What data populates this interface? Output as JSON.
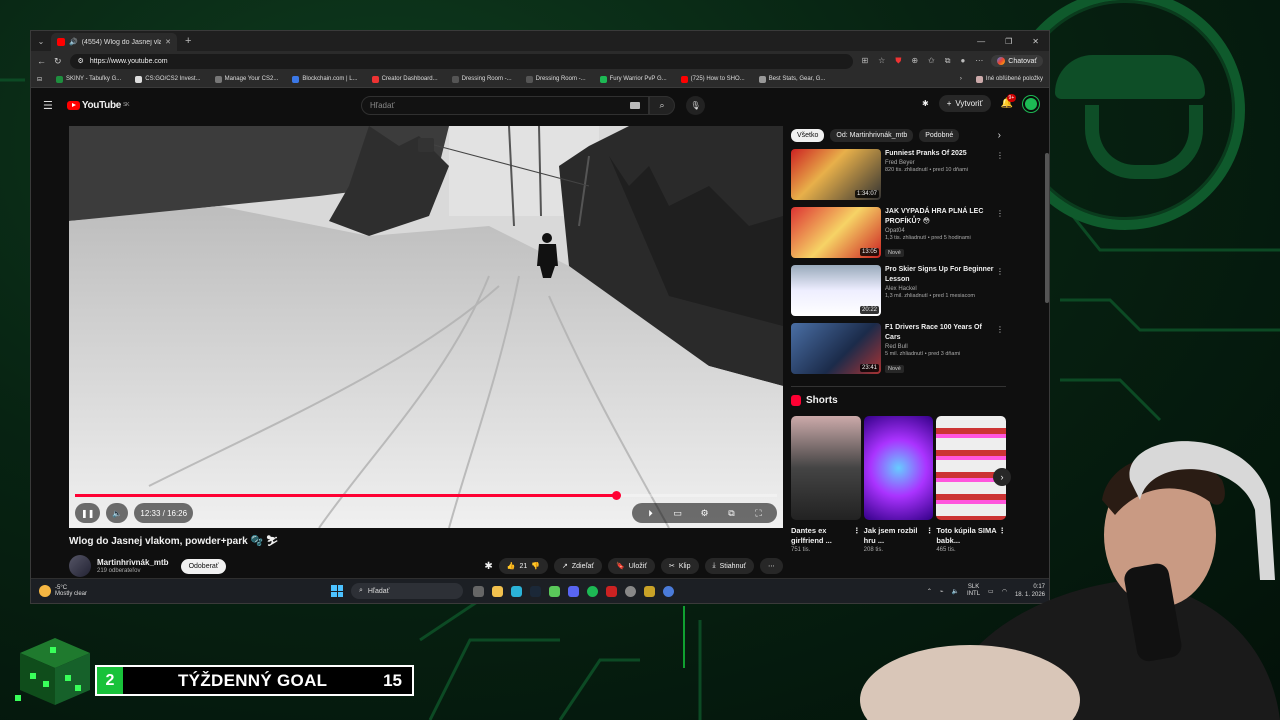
{
  "browser": {
    "tab_title": "(4554) Wlog do Jasnej vlakom",
    "url": "https://www.youtube.com",
    "chat_label": "Chatovať",
    "bookmarks": [
      "SKINY - Tabuľky G...",
      "CS:GO/CS2 Invest...",
      "Manage Your CS2...",
      "Blockchain.com | L...",
      "Creator Dashboard...",
      "Dressing Room -...",
      "Dressing Room -...",
      "Fury Warrior PvP G...",
      "(725) How to SHO...",
      "Best Stats, Gear, G..."
    ],
    "bookmarks_other": "Iné obľúbené položky"
  },
  "youtube": {
    "logo": "YouTube",
    "logo_region": "SK",
    "search_placeholder": "Hľadať",
    "create_label": "Vytvoriť",
    "notif_count": "9+",
    "player": {
      "time": "12:33 / 16:26",
      "progress": 0.77
    },
    "video_title": "Wlog do Jasnej vlakom, powder+park",
    "channel_name": "Martinhrivnák_mtb",
    "channel_subs": "219 odberateľov",
    "subscribe_label": "Odoberať",
    "actions": {
      "likes": "21",
      "share": "Zdieľať",
      "save": "Uložiť",
      "clip": "Klip",
      "download": "Stiahnuť"
    },
    "chips": [
      "Všetko",
      "Od: Martinhrivnák_mtb",
      "Podobné"
    ],
    "recommended": [
      {
        "title": "Funniest Pranks Of 2025",
        "channel": "Fred Beyer",
        "stats": "820 tis. zhliadnutí • pred 10 dňami",
        "duration": "1:34:07",
        "new": ""
      },
      {
        "title": "JAK VYPADÁ HRA PLNÁ LEC PROFÍKŮ? 😳",
        "channel": "Opat04",
        "stats": "1,3 tis. zhliadnutí • pred 5 hodinami",
        "duration": "13:05",
        "new": "Nové"
      },
      {
        "title": "Pro Skier Signs Up For Beginner Lesson",
        "channel": "Alex Hackel",
        "stats": "1,3 mil. zhliadnutí • pred 1 mesiacom",
        "duration": "20:22",
        "new": ""
      },
      {
        "title": "F1 Drivers Race 100 Years Of Cars",
        "channel": "Red Bull",
        "stats": "5 mil. zhliadnutí • pred 3 dňami",
        "duration": "23:41",
        "new": "Nové"
      }
    ],
    "shorts_title": "Shorts",
    "shorts": [
      {
        "title": "Dantes ex girlfriend ...",
        "views": "751 tis."
      },
      {
        "title": "Jak jsem rozbil hru ...",
        "views": "208 tis."
      },
      {
        "title": "Toto kúpila SIMA babk...",
        "views": "465 tis."
      }
    ]
  },
  "taskbar": {
    "temp": "-5°C",
    "weather": "Mostly clear",
    "search": "Hľadať",
    "lang": "SLK",
    "lang2": "INTL",
    "time": "0:17",
    "date": "18. 1. 2026"
  },
  "overlay": {
    "goal_current": "2",
    "goal_label": "TÝŽDENNÝ GOAL",
    "goal_target": "15"
  }
}
